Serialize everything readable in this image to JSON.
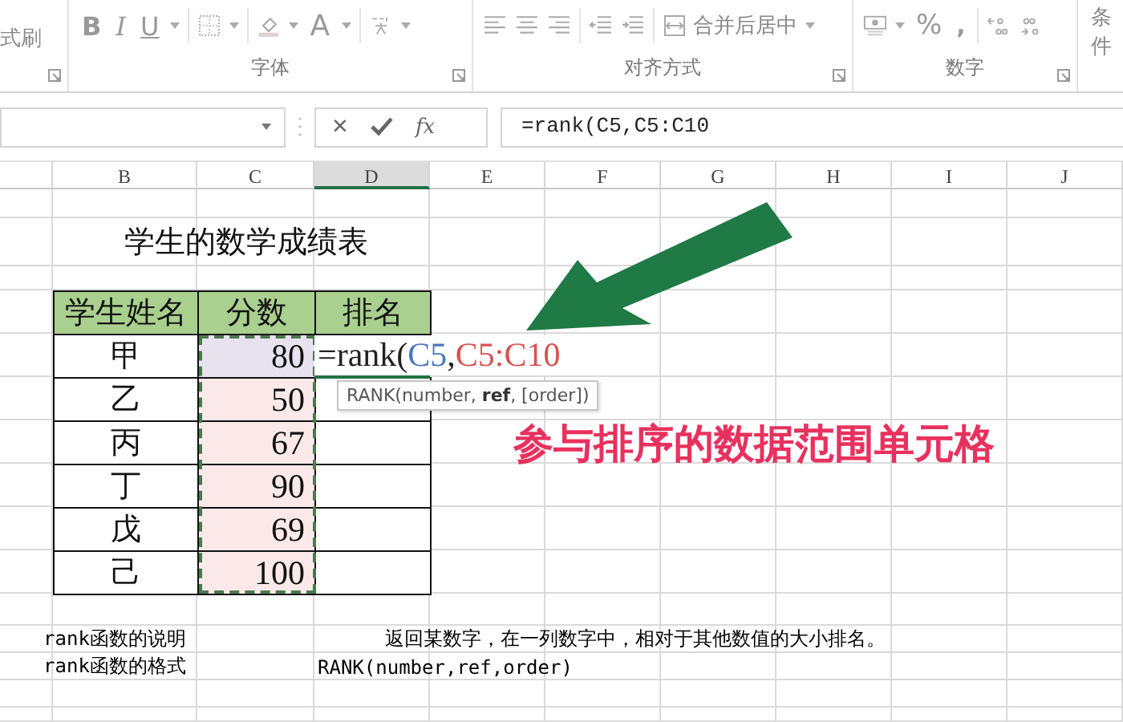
{
  "ribbon": {
    "clipboard": {
      "item": "式刷"
    },
    "font_group": {
      "label": "字体",
      "bold": "B",
      "italic": "I",
      "underline": "U",
      "font_color": "A"
    },
    "align_group": {
      "label": "对齐方式",
      "merge_button": "合并后居中"
    },
    "number_group": {
      "label": "数字",
      "percent": "%",
      "comma": ","
    },
    "cut_group": {
      "item": "条件"
    }
  },
  "formula_bar": {
    "cancel": "×",
    "fx": "fx",
    "value": "=rank(C5,C5:C10"
  },
  "columns": [
    {
      "selected": false
    },
    {
      "label": "B",
      "selected": false
    },
    {
      "label": "C",
      "selected": false
    },
    {
      "label": "D",
      "selected": true
    },
    {
      "label": "E",
      "selected": false
    },
    {
      "label": "F",
      "selected": false
    },
    {
      "label": "G",
      "selected": false
    },
    {
      "label": "H",
      "selected": false
    },
    {
      "label": "I",
      "selected": false
    },
    {
      "label": "J",
      "selected": false
    }
  ],
  "sheet": {
    "title": "学生的数学成绩表",
    "headers": [
      "学生姓名",
      "分数",
      "排名"
    ],
    "rows": [
      {
        "name": "甲",
        "score": "80"
      },
      {
        "name": "乙",
        "score": "50"
      },
      {
        "name": "丙",
        "score": "67"
      },
      {
        "name": "丁",
        "score": "90"
      },
      {
        "name": "戊",
        "score": "69"
      },
      {
        "name": "己",
        "score": "100"
      }
    ],
    "editor": [
      {
        "text": "=rank(",
        "color": "#222222"
      },
      {
        "text": "C5",
        "color": "#4a78c2"
      },
      {
        "text": ",",
        "color": "#222222"
      },
      {
        "text": "C5:C10",
        "color": "#d9534f"
      }
    ],
    "tooltip": "RANK(number, **ref**, [order])",
    "notes": [
      {
        "label": "rank函数的说明",
        "value": "返回某数字，在一列数字中，相对于其他数值的大小排名。"
      },
      {
        "label": "rank函数的格式",
        "value": "RANK(number,ref,order)"
      }
    ]
  },
  "annotation": "参与排序的数据范围单元格"
}
